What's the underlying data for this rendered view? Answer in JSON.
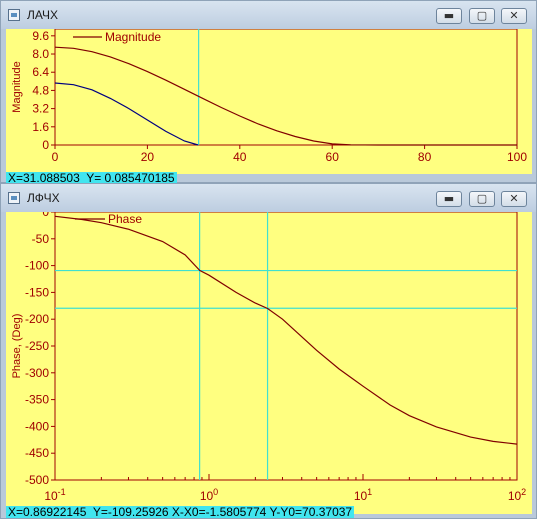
{
  "window1": {
    "title": "ЛАЧХ",
    "buttons": {
      "minimize": "▬",
      "maximize": "▢",
      "close": "✕"
    },
    "readout": "X=31.088503  Y= 0.085470185",
    "plot_bg": "#ffff80",
    "axis_color": "#a00000",
    "curve_color": "#800000",
    "cursor_color": "#40e0d0"
  },
  "window2": {
    "title": "ЛФЧХ",
    "buttons": {
      "minimize": "▬",
      "maximize": "▢",
      "close": "✕"
    },
    "readout": "X=0.86922145  Y=-109.25926 X-X0=-1.5805774 Y-Y0=70.37037"
  },
  "chart_data": [
    {
      "type": "line",
      "legend": [
        "Magnitude"
      ],
      "legend_position": "top-left",
      "ylabel": "Magnitude",
      "xlabel": "",
      "xlim": [
        0,
        100
      ],
      "ylim": [
        0,
        10.2
      ],
      "x_ticks": [
        0,
        20,
        40,
        60,
        80,
        100
      ],
      "x_tick_labels": [
        "0",
        "20",
        "40",
        "60",
        "80",
        "100"
      ],
      "y_ticks": [
        0,
        1.6,
        3.2,
        4.8,
        6.4,
        8.0,
        9.6
      ],
      "y_tick_labels": [
        "0",
        "1.6",
        "3.2",
        "4.8",
        "6.4",
        "8.0",
        "9.6"
      ],
      "series": [
        {
          "name": "Magnitude",
          "color": "#800000",
          "x": [
            0,
            4,
            8,
            12,
            16,
            20,
            24,
            28,
            32,
            36,
            40,
            44,
            48,
            52,
            56,
            60,
            64,
            70,
            80,
            90,
            100
          ],
          "y": [
            8.6,
            8.5,
            8.2,
            7.75,
            7.15,
            6.45,
            5.7,
            4.9,
            4.1,
            3.3,
            2.55,
            1.85,
            1.25,
            0.75,
            0.35,
            0.1,
            0.02,
            0,
            0,
            0,
            0
          ]
        },
        {
          "name": "",
          "color": "#000080",
          "x": [
            0,
            4,
            8,
            12,
            16,
            20,
            24,
            28,
            31
          ],
          "y": [
            5.45,
            5.3,
            4.85,
            4.1,
            3.2,
            2.2,
            1.2,
            0.35,
            0
          ]
        }
      ],
      "cursor_x": 31.088503
    },
    {
      "type": "line",
      "legend": [
        "Phase"
      ],
      "legend_position": "top-left",
      "ylabel": "Phase, (Deg)",
      "xlabel": "",
      "xscale": "log",
      "xlim": [
        0.1,
        100
      ],
      "ylim": [
        -500,
        0
      ],
      "x_tick_labels": [
        "10-1",
        "100",
        "101",
        "102"
      ],
      "y_ticks": [
        0,
        -50,
        -100,
        -150,
        -200,
        -250,
        -300,
        -350,
        -400,
        -450,
        -500
      ],
      "y_tick_labels": [
        "0",
        "-50",
        "-100",
        "-150",
        "-200",
        "-250",
        "-300",
        "-350",
        "-400",
        "-450",
        "-500"
      ],
      "series": [
        {
          "name": "Phase",
          "color": "#800000",
          "x": [
            0.1,
            0.15,
            0.2,
            0.3,
            0.5,
            0.7,
            0.87,
            1.0,
            1.5,
            2.0,
            2.4,
            3,
            5,
            7,
            10,
            15,
            20,
            30,
            50,
            70,
            100
          ],
          "y": [
            -8,
            -14,
            -20,
            -32,
            -55,
            -80,
            -109,
            -118,
            -150,
            -170,
            -180,
            -200,
            -258,
            -293,
            -325,
            -360,
            -380,
            -401,
            -420,
            -428,
            -433
          ]
        }
      ],
      "cursor_v": [
        0.86922145,
        2.4
      ],
      "cursor_h": [
        -109.25926,
        -179.6
      ]
    }
  ]
}
